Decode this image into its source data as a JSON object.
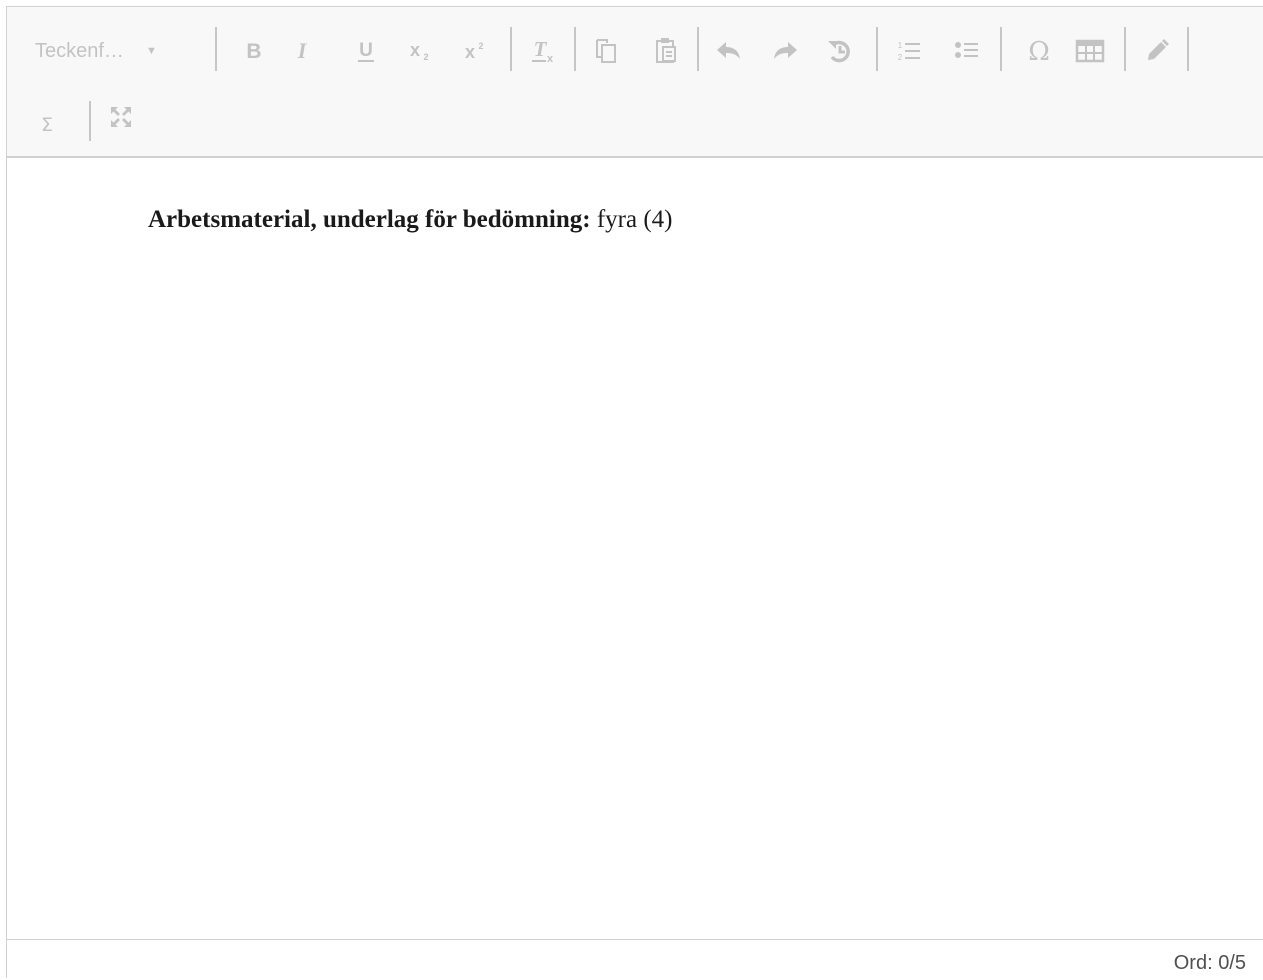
{
  "toolbar": {
    "font_select_label": "Teckenf…",
    "buttons": [
      "bold-button",
      "italic-button",
      "underline-button",
      "subscript-button",
      "superscript-button",
      "remove-format-button",
      "copy-button",
      "paste-button",
      "undo-button",
      "redo-button",
      "restore-button",
      "numbered-list-button",
      "bullet-list-button",
      "special-character-button",
      "table-button",
      "draw-button",
      "math-button",
      "fullscreen-button"
    ],
    "icon_color": "#c3c3c3"
  },
  "content": {
    "bold_text": "Arbetsmaterial, underlag för bedömning:",
    "normal_text": "fyra (4)"
  },
  "status": {
    "word_count": "Ord: 0/5"
  }
}
